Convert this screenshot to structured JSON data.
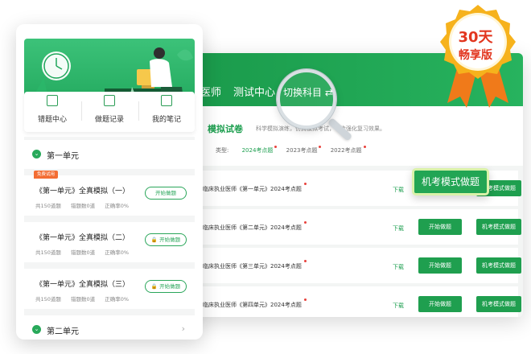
{
  "desktop": {
    "nav": [
      "业医师",
      "测试中心"
    ],
    "switch_subject": "切换科目",
    "section_title": "模拟试卷",
    "section_desc": "科学模拟演练，仿真模拟考试，一步强化复习效果。",
    "filter_label": "类型:",
    "filters": [
      "2024考点题",
      "2023考点题",
      "2022考点题"
    ],
    "rows": [
      {
        "title": "临床执业医师《第一单元》2024考点题",
        "download": "下载",
        "start": "",
        "exam": "机考模式做题"
      },
      {
        "title": "临床执业医师《第二单元》2024考点题",
        "download": "下载",
        "start": "开始做题",
        "exam": "机考模式做题"
      },
      {
        "title": "临床执业医师《第三单元》2024考点题",
        "download": "下载",
        "start": "开始做题",
        "exam": "机考模式做题"
      },
      {
        "title": "临床执业医师《第四单元》2024考点题",
        "download": "下载",
        "start": "开始做题",
        "exam": "机考模式做题"
      }
    ],
    "highlight_button": "机考模式做题"
  },
  "mobile": {
    "menu": [
      {
        "label": "错题中心",
        "icon": "error-book-icon"
      },
      {
        "label": "做题记录",
        "icon": "record-list-icon"
      },
      {
        "label": "我的笔记",
        "icon": "note-pen-icon"
      }
    ],
    "unit1": "第一单元",
    "unit2": "第二单元",
    "free_tag": "免费试用",
    "papers": [
      {
        "name": "《第一单元》全真模拟（一）",
        "total": "共150道题",
        "wrong": "错题数0道",
        "rate": "正确率0%",
        "action": "开始做题"
      },
      {
        "name": "《第一单元》全真模拟（二）",
        "total": "共150道题",
        "wrong": "错题数0道",
        "rate": "正确率0%",
        "action": "开始做题"
      },
      {
        "name": "《第一单元》全真模拟（三）",
        "total": "共150道题",
        "wrong": "错题数0道",
        "rate": "正确率0%",
        "action": "开始做题"
      }
    ]
  },
  "badge": {
    "line1": "30天",
    "line2": "畅享版"
  },
  "colors": {
    "brand_green": "#1f9f4f",
    "badge_red": "#e2361f",
    "badge_gold": "#f6b21c",
    "tag_orange": "#f36d33"
  }
}
